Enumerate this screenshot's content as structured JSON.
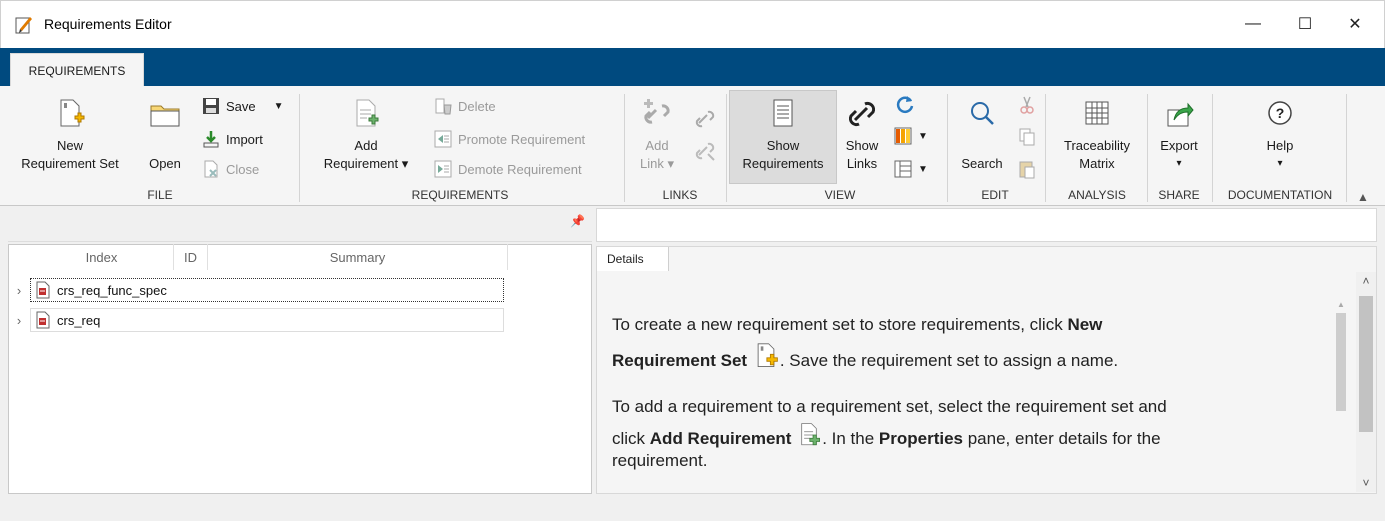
{
  "window": {
    "title": "Requirements Editor",
    "minimize": "—",
    "maximize": "☐",
    "close": "✕"
  },
  "tabs": {
    "requirements": "REQUIREMENTS"
  },
  "ribbon": {
    "file": {
      "new_line1": "New",
      "new_line2": "Requirement Set",
      "open": "Open",
      "save": "Save",
      "import": "Import",
      "close": "Close",
      "group": "FILE"
    },
    "requirements": {
      "add_line1": "Add",
      "add_line2": "Requirement ▾",
      "delete": "Delete",
      "promote": "Promote Requirement",
      "demote": "Demote Requirement",
      "group": "REQUIREMENTS"
    },
    "links": {
      "add_line1": "Add",
      "add_line2": "Link ▾",
      "group": "LINKS"
    },
    "view": {
      "show_req_line1": "Show",
      "show_req_line2": "Requirements",
      "show_links_line1": "Show",
      "show_links_line2": "Links",
      "group": "VIEW"
    },
    "edit": {
      "search": "Search",
      "group": "EDIT"
    },
    "analysis": {
      "trace_line1": "Traceability",
      "trace_line2": "Matrix",
      "group": "ANALYSIS"
    },
    "share": {
      "export": "Export",
      "arrow": "▾",
      "group": "SHARE"
    },
    "documentation": {
      "help": "Help",
      "arrow": "▾",
      "group": "DOCUMENTATION"
    }
  },
  "tree": {
    "columns": {
      "index": "Index",
      "id": "ID",
      "summary": "Summary"
    },
    "rows": [
      {
        "label": "crs_req_func_spec"
      },
      {
        "label": "crs_req"
      }
    ]
  },
  "details": {
    "tab": "Details",
    "p1a": "To create a new requirement set to store requirements, click ",
    "p1b": "New",
    "p1c": "Requirement Set",
    "p1d": ". Save the requirement set to assign a name.",
    "p2a": "To add a requirement to a requirement set, select the requirement set and",
    "p2b": "click ",
    "p2c": "Add Requirement",
    "p2d": ". In the ",
    "p2e": "Properties",
    "p2f": " pane, enter details for the",
    "p2g": "requirement."
  }
}
